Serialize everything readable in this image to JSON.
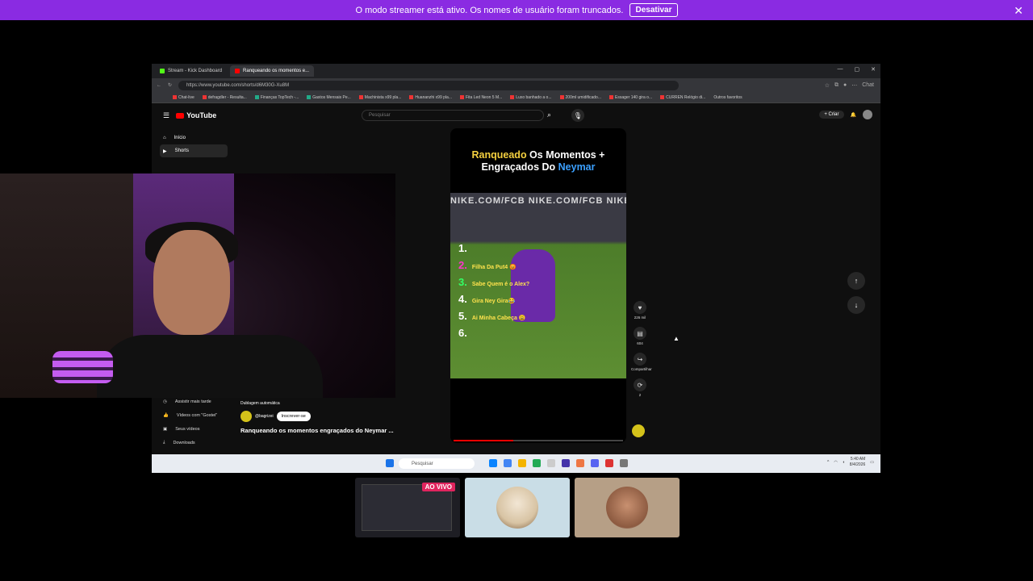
{
  "banner": {
    "message": "O modo streamer está ativo. Os nomes de usuário foram truncados.",
    "button": "Desativar",
    "close": "✕"
  },
  "browser": {
    "tabs": [
      {
        "label": "Stream - Kick Dashboard",
        "color": "#53fc18"
      },
      {
        "label": "Ranqueando os momentos e...",
        "color": "#ff0000"
      }
    ],
    "url": "https://www.youtube.com/shorts/d6M30G-Xu8M",
    "bookmarks": [
      "Chat-live",
      "defragdler - Resulta...",
      "Finanças TopTech -...",
      "Gastos Mensais Pe...",
      "Machinista x99 pla...",
      "Huananzhi x99 pla...",
      "Fita Led Neon 5 M...",
      "Luxo banhado a o...",
      "200ml umidificado...",
      "Essager 140 gira o...",
      "CURREN Relógio di...",
      "Outros favoritos"
    ],
    "chat_label": "Chat"
  },
  "youtube": {
    "logo": "YouTube",
    "search_placeholder": "Pesquisar",
    "create": "Criar",
    "sidebar": [
      {
        "label": "Início",
        "icon": "home-icon"
      },
      {
        "label": "Shorts",
        "icon": "shorts-icon"
      }
    ],
    "sidebar_bottom": [
      {
        "label": "Assistir mais tarde",
        "icon": "clock-icon"
      },
      {
        "label": "Vídeos com \"Gostei\"",
        "icon": "thumbs-up-icon"
      },
      {
        "label": "Seus vídeos",
        "icon": "video-icon"
      },
      {
        "label": "Downloads",
        "icon": "download-icon"
      }
    ]
  },
  "short": {
    "title_parts": {
      "a": "Ranqueado",
      "b": " Os Momentos + Engraçados Do ",
      "c": "Neymar"
    },
    "wall_text": "NIKE.COM/FCB   NIKE.COM/FCB   NIKE",
    "ranks": [
      {
        "n": "1.",
        "text": ""
      },
      {
        "n": "2.",
        "text": "Filha Da Put4 😡"
      },
      {
        "n": "3.",
        "text": "Sabe Quem é o Alex?"
      },
      {
        "n": "4.",
        "text": "Gira Ney Gira😂"
      },
      {
        "n": "5.",
        "text": "Ai Minha Cabeça 😩"
      },
      {
        "n": "6.",
        "text": ""
      }
    ],
    "progress_fraction": 0.35,
    "likes": "226 mil",
    "comments": "604",
    "share": "Compartilhar",
    "remix": "2",
    "dubbing": "Dublagem automática",
    "channel": "@bagrizei",
    "subscribe": "Inscrever-se",
    "video_title": "Ranqueando os momentos engraçados do Neymar ..."
  },
  "taskbar": {
    "search": "Pesquisar",
    "time": "5:40 AM",
    "date": "8/4/2026"
  },
  "stream": {
    "live_badge": "AO VIVO"
  }
}
